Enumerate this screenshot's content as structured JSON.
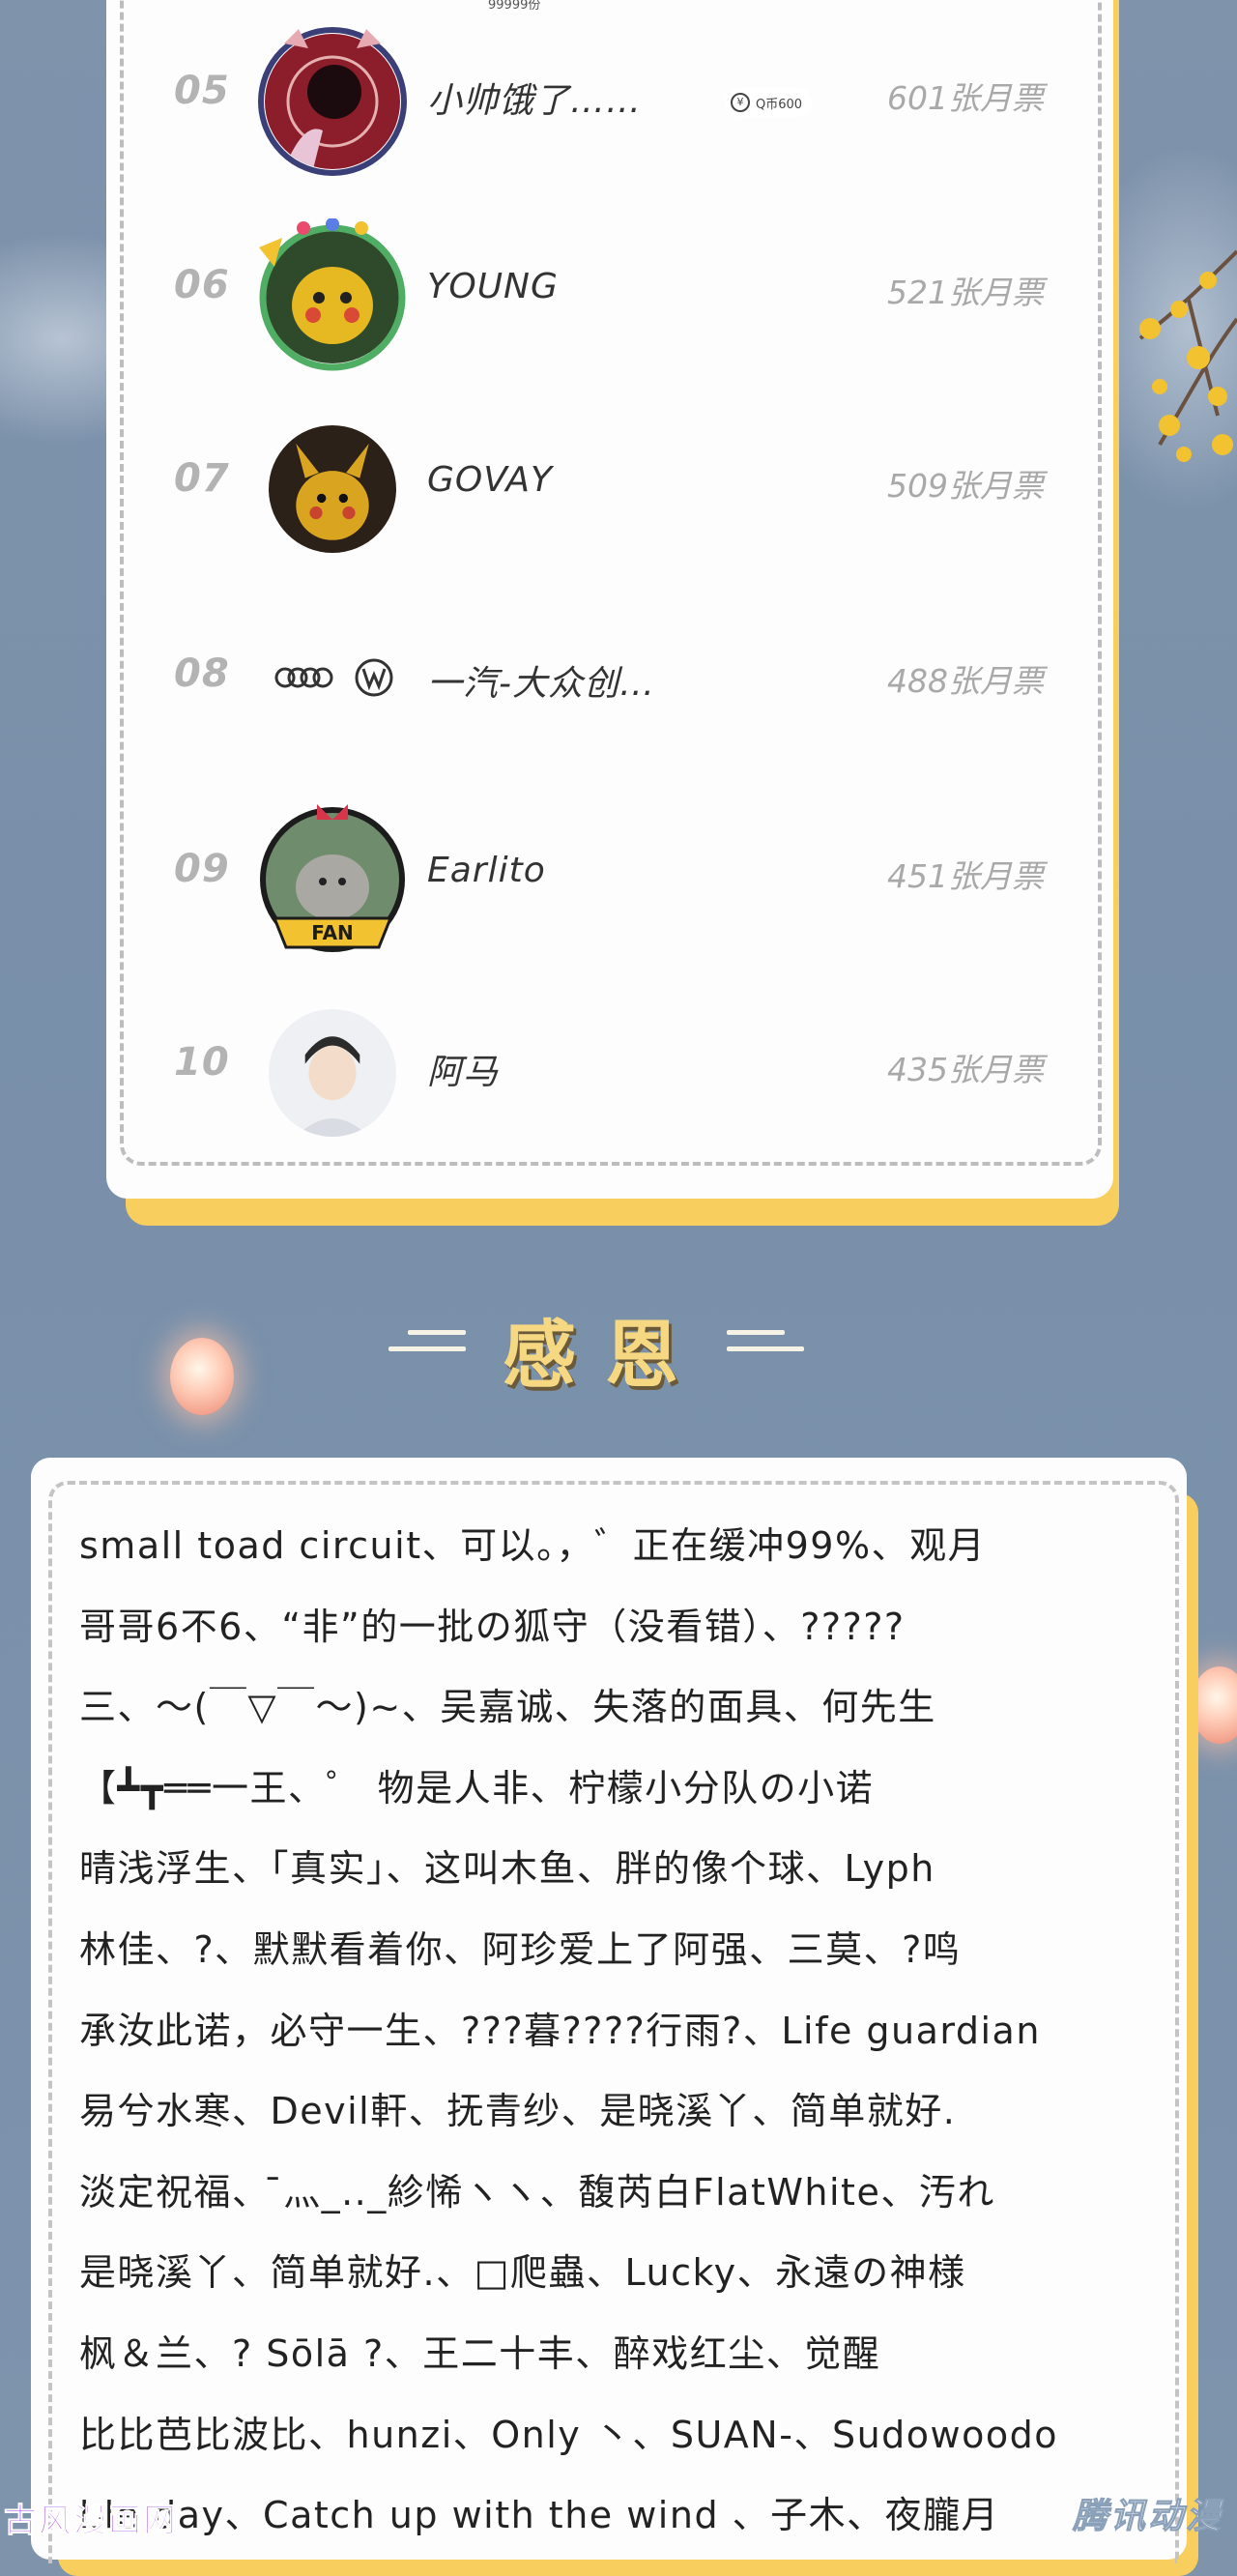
{
  "ranking": {
    "top_fragment": "99999份",
    "rows": [
      {
        "rank": "05",
        "name": "小帅饿了……",
        "votes": "601张月票",
        "badge": "Q币600"
      },
      {
        "rank": "06",
        "name": "YOUNG",
        "votes": "521张月票"
      },
      {
        "rank": "07",
        "name": "GOVAY",
        "votes": "509张月票"
      },
      {
        "rank": "08",
        "name": "一汽-大众创…",
        "votes": "488张月票"
      },
      {
        "rank": "09",
        "name": "Earlito",
        "votes": "451张月票",
        "badge": "FAN"
      },
      {
        "rank": "10",
        "name": "阿马",
        "votes": "435张月票"
      }
    ],
    "coin_symbol": "¥"
  },
  "heading": {
    "title": "感恩"
  },
  "thanks": {
    "lines": [
      "small toad circuit、可以。，゛正在缓冲99%、观月",
      "哥哥6不6、“非”的一批の狐守（没看错）、?????",
      "三、～(￣▽￣～)~、吴嘉诚、失落的面具、何先生",
      "【┻┳══一王、゜  物是人非、柠檬小分队の小诺",
      "晴浅浮生、「真实」、这叫木鱼、胖的像个球、Lyph",
      "林佳、?、默默看着你、阿珍爱上了阿强、三莫、?鸣",
      "承汝此诺，必守一生、???暮????行雨?、Life guardian",
      "易兮水寒、Devil軒、抚青纱、是晓溪丫、简单就好.",
      "淡定祝福、 ̄灬_.._紾悕ヽヽ、馥芮白FlatWhite、汚れ",
      "是晓溪丫、简单就好.、□爬蟲、Lucky、永遠の神様",
      "枫＆兰、? Sōlā ?、王二十丰、醉戏红尘、觉醒",
      "比比芭比波比、hunzi、Only 丶、SUAN-、Sudowoodo",
      "ble day、Catch up with the wind 、子木、夜朧月"
    ]
  },
  "watermarks": {
    "left": "古风漫画网",
    "right": "腾讯动漫"
  },
  "colors": {
    "background": "#7f93ab",
    "accent": "#f8cf5f",
    "heading": "#f6d883",
    "muted": "#a9a9a9"
  }
}
